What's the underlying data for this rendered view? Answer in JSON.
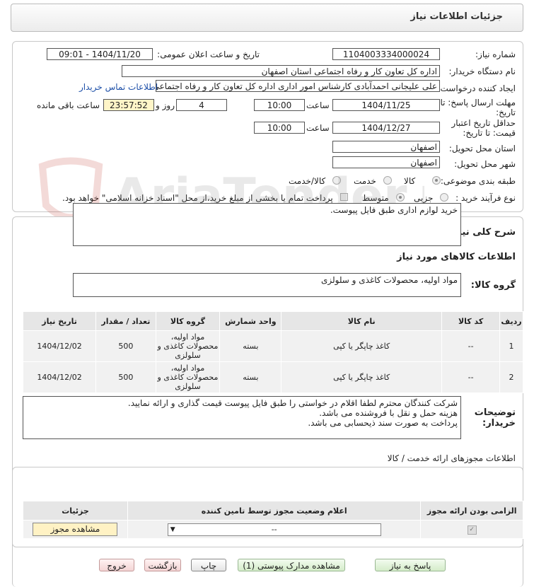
{
  "header": {
    "title": "جزئیات اطلاعات نیاز"
  },
  "form": {
    "need_number_label": "شماره نیاز:",
    "need_number": "1104003334000024",
    "announce_label": "تاریخ و ساعت اعلان عمومی:",
    "announce_value": "1404/11/20 - 09:01",
    "buyer_label": "نام دستگاه خریدار:",
    "buyer_value": "اداره کل تعاون  کار و رفاه اجتماعی استان اصفهان",
    "creator_label": "ایجاد کننده درخواست:",
    "creator_value": "علی علیجانی احمدآبادی کارشناس امور اداری  اداره کل تعاون  کار و رفاه اجتماعی",
    "contact_link": "اطلاعات تماس خریدار",
    "deadline_label_1": "مهلت ارسال پاسخ: تا",
    "deadline_label_2": "تاریخ:",
    "deadline_date": "1404/11/25",
    "time_label": "ساعت",
    "deadline_time": "10:00",
    "days_value": "4",
    "days_label": "روز و",
    "remaining_value": "23:57:52",
    "remaining_label": "ساعت باقی مانده",
    "validity_label_1": "حداقل تاریخ اعتبار",
    "validity_label_2": "قیمت: تا تاریخ:",
    "validity_date": "1404/12/27",
    "validity_time": "10:00",
    "province_label": "استان محل تحویل:",
    "province_value": "اصفهان",
    "city_label": "شهر محل تحویل:",
    "city_value": "اصفهان",
    "category_label": "طبقه بندی موضوعی:",
    "category_options": [
      "کالا",
      "خدمت",
      "کالا/خدمت"
    ],
    "process_label": "نوع فرآیند خرید :",
    "process_options": [
      "جزیی",
      "متوسط"
    ],
    "payment_note": "پرداخت تمام یا بخشی از مبلغ خرید،از محل \"اسناد خزانه اسلامی\" خواهد بود."
  },
  "need_desc": {
    "label": "شرح کلی نیاز:",
    "value": "خرید لوازم اداری طبق فایل پیوست."
  },
  "goods_info": {
    "title": "اطلاعات کالاهای مورد نیاز",
    "group_label": "گروه کالا:",
    "group_value": "مواد اولیه، محصولات کاغذی و سلولزی"
  },
  "table": {
    "headers": [
      "ردیف",
      "کد کالا",
      "نام کالا",
      "واحد شمارش",
      "گروه کالا",
      "تعداد / مقدار",
      "تاریخ نیاز"
    ],
    "rows": [
      [
        "1",
        "--",
        "کاغذ چاپگر یا کپی",
        "بسته",
        "مواد اولیه، محصولات کاغذی و سلولزی",
        "500",
        "1404/12/02"
      ],
      [
        "2",
        "--",
        "کاغذ چاپگر یا کپی",
        "بسته",
        "مواد اولیه، محصولات کاغذی و سلولزی",
        "500",
        "1404/12/02"
      ]
    ]
  },
  "buyer_notes": {
    "label_1": "توضیحات",
    "label_2": "خریدار:",
    "lines": [
      "شرکت کنندگان محترم لطفا اقلام در خواستی را طبق فایل پیوست قیمت گذاری و ارائه نمایید.",
      "هزینه حمل و نقل با فروشنده می باشد.",
      "پرداخت به صورت سند ذیحسابی می باشد."
    ]
  },
  "permits": {
    "title": "اطلاعات مجوزهای ارائه خدمت / کالا",
    "headers": [
      "الزامی بودن ارائه مجوز",
      "اعلام وضعیت مجوز توسط تامین کننده",
      "جزئیات"
    ],
    "select_value": "--",
    "view_button": "مشاهده مجوز"
  },
  "buttons": {
    "reply": "پاسخ به نیاز",
    "view_docs": "مشاهده مدارک پیوستی (1)",
    "print": "چاپ",
    "back": "بازگشت",
    "exit": "خروج"
  },
  "watermark": "AriaTender.net",
  "colors": {
    "link": "#1d4fa8",
    "highlight": "#fff5c8",
    "accent_green": "#d4ecc9",
    "accent_pink": "#f3d4d4"
  }
}
